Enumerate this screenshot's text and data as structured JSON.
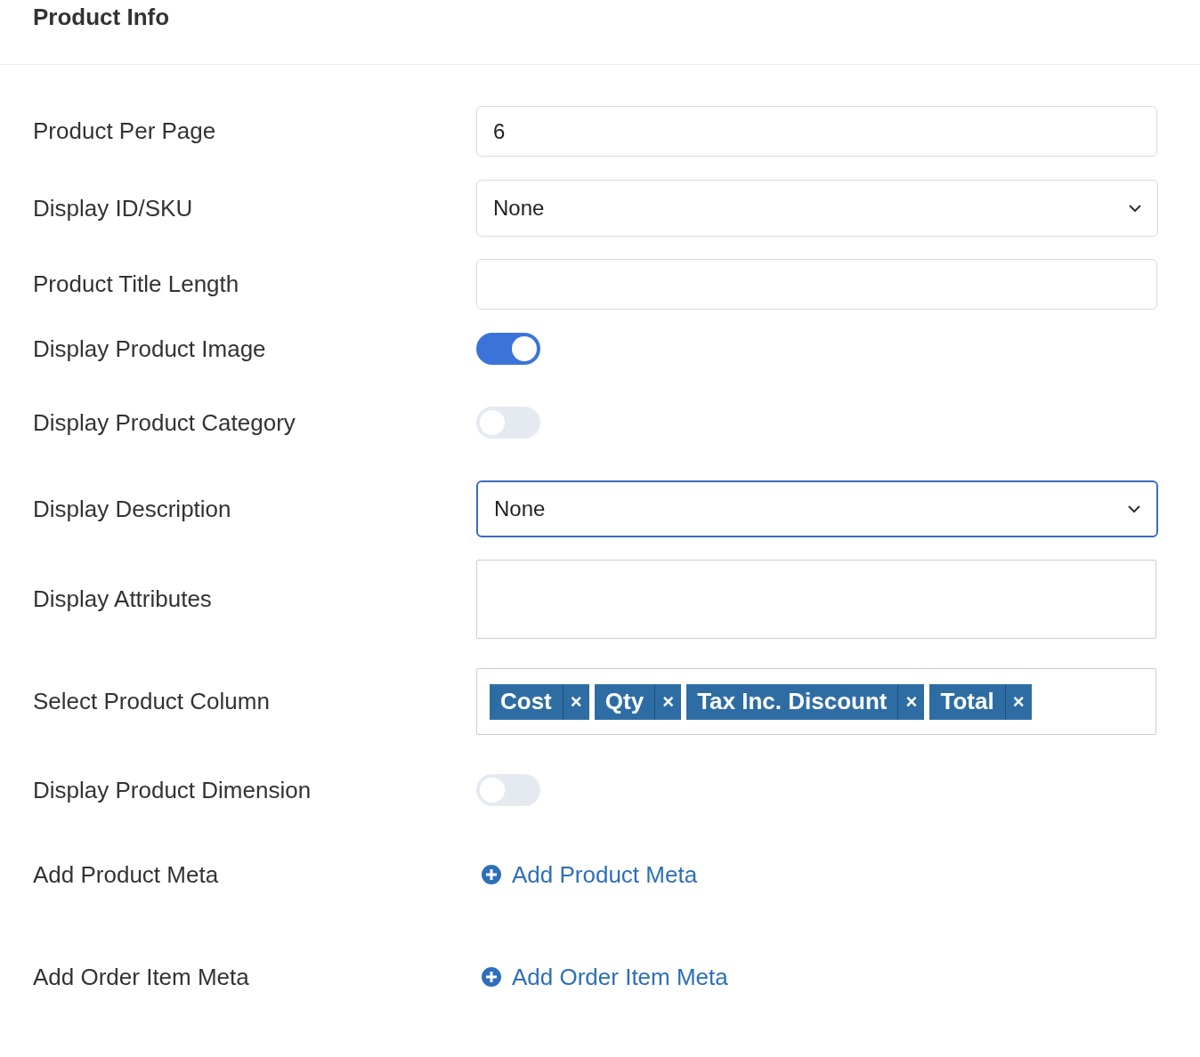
{
  "title": "Product Info",
  "rows": [
    {
      "label": "Product Per Page",
      "kind": "text",
      "value": "6"
    },
    {
      "label": "Display ID/SKU",
      "kind": "select",
      "value": "None",
      "focused": false
    },
    {
      "label": "Product Title Length",
      "kind": "text",
      "value": ""
    },
    {
      "label": "Display Product Image",
      "kind": "toggle",
      "on": true
    },
    {
      "label": "Display Product Category",
      "kind": "toggle",
      "on": false
    },
    {
      "label": "Display Description",
      "kind": "select",
      "value": "None",
      "focused": true
    },
    {
      "label": "Display Attributes",
      "kind": "textarea"
    },
    {
      "label": "Select Product Column",
      "kind": "tags",
      "tags": [
        {
          "label": "Cost",
          "remove": "×"
        },
        {
          "label": "Qty",
          "remove": "×"
        },
        {
          "label": "Tax Inc. Discount",
          "remove": "×"
        },
        {
          "label": "Total",
          "remove": "×"
        }
      ]
    },
    {
      "label": "Display Product Dimension",
      "kind": "toggle",
      "on": false
    },
    {
      "label": "Add Product Meta",
      "kind": "link",
      "link": "Add Product Meta"
    },
    {
      "label": "Add Order Item Meta",
      "kind": "link",
      "link": "Add Order Item Meta"
    }
  ]
}
